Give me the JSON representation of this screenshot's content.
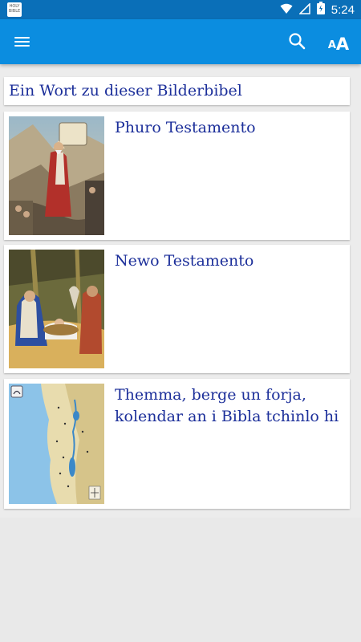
{
  "status_bar": {
    "time": "5:24",
    "app_icon_text": "HOLY BIBLE"
  },
  "app_bar": {
    "menu_icon": "menu-icon",
    "search_icon": "search-icon",
    "font_icon": "font-size-icon",
    "font_small": "A",
    "font_big": "A"
  },
  "cards": {
    "intro": {
      "title": "Ein Wort zu dieser Bilderbibel"
    },
    "old_testament": {
      "title": "Phuro Testamento"
    },
    "new_testament": {
      "title": "Newo Testamento"
    },
    "topics": {
      "title": "Themma, berge un forja, kolendar an i Bibla tchinlo hi"
    }
  },
  "colors": {
    "status_bar": "#0a6fb8",
    "app_bar": "#0b8de0",
    "title_text": "#1c2f9a",
    "background": "#ececec"
  }
}
